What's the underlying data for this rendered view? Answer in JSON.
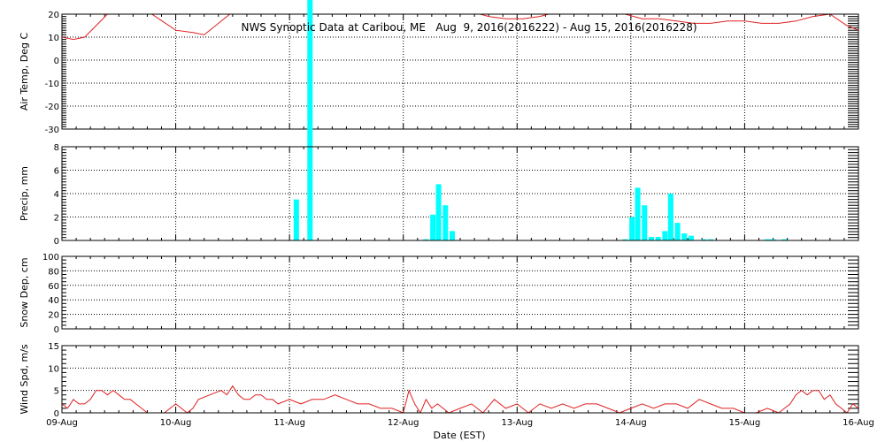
{
  "chart_data": {
    "type": "line",
    "title": "NWS Synoptic Data at Caribou, ME   Aug  9, 2016(2016222) - Aug 15, 2016(2016228)",
    "xlabel": "Date (EST)",
    "x_ticks": [
      "09-Aug",
      "10-Aug",
      "11-Aug",
      "12-Aug",
      "13-Aug",
      "14-Aug",
      "15-Aug",
      "16-Aug"
    ],
    "xlim_days": [
      0,
      7
    ],
    "grid": true,
    "colors": {
      "line": "#e02020",
      "bar": "#00ffff",
      "grid": "#000000"
    },
    "panels": [
      {
        "id": "air_temp",
        "type": "line",
        "ylabel": "Air Temp, Deg C",
        "ylim": [
          -30,
          20
        ],
        "y_ticks": [
          20,
          10,
          0,
          -10,
          -20,
          -30
        ],
        "series": [
          {
            "x": [
              0.0,
              0.1,
              0.2,
              0.3,
              0.4,
              0.55,
              0.7,
              0.85,
              1.0,
              1.15,
              1.25,
              1.35,
              1.5,
              1.65,
              1.8,
              1.95,
              2.1,
              2.25,
              2.4,
              2.55,
              2.7,
              2.85,
              3.0,
              3.15,
              3.3,
              3.45,
              3.6,
              3.75,
              3.9,
              4.05,
              4.2,
              4.35,
              4.5,
              4.65,
              4.8,
              4.95,
              5.1,
              5.25,
              5.4,
              5.55,
              5.7,
              5.85,
              6.0,
              6.15,
              6.3,
              6.45,
              6.6,
              6.75,
              6.9,
              7.0
            ],
            "y": [
              10,
              9,
              10,
              15,
              20,
              22,
              23,
              18,
              13,
              12,
              11,
              15,
              21,
              24,
              22,
              20,
              20,
              21,
              21,
              23,
              23,
              24,
              24,
              22,
              21,
              20,
              21,
              19,
              18,
              18,
              19,
              21,
              22,
              23,
              22,
              20,
              18,
              18,
              17,
              16,
              16,
              17,
              17,
              16,
              16,
              17,
              19,
              20,
              15,
              13
            ]
          }
        ]
      },
      {
        "id": "precip",
        "type": "bar",
        "ylabel": "Precip, mm",
        "ylim": [
          0,
          8
        ],
        "y_ticks": [
          8,
          6,
          4,
          2,
          0
        ],
        "bars": {
          "x": [
            2.06,
            2.18,
            3.2,
            3.26,
            3.31,
            3.37,
            3.43,
            4.95,
            5.01,
            5.06,
            5.12,
            5.18,
            5.24,
            5.3,
            5.35,
            5.41,
            5.47,
            5.53,
            5.64,
            5.7,
            6.2,
            6.25,
            6.35
          ],
          "y": [
            3.5,
            30,
            0.1,
            2.2,
            4.8,
            3.0,
            0.8,
            0.1,
            2.0,
            4.5,
            3.0,
            0.3,
            0.3,
            0.8,
            4.0,
            1.5,
            0.6,
            0.4,
            0.1,
            0.1,
            0.1,
            0.1,
            0.1
          ]
        }
      },
      {
        "id": "snow_depth",
        "type": "line",
        "ylabel": "Snow Dep, cm",
        "ylim": [
          0,
          100
        ],
        "y_ticks": [
          100,
          80,
          60,
          40,
          20,
          0
        ],
        "series": []
      },
      {
        "id": "wind_speed",
        "type": "line",
        "ylabel": "Wind Spd, m/s",
        "ylim": [
          0,
          15
        ],
        "y_ticks": [
          15,
          10,
          5,
          0
        ],
        "series": [
          {
            "x": [
              0.0,
              0.05,
              0.1,
              0.15,
              0.2,
              0.25,
              0.3,
              0.35,
              0.4,
              0.45,
              0.5,
              0.55,
              0.6,
              0.65,
              0.7,
              0.75,
              0.8,
              0.85,
              0.9,
              1.0,
              1.1,
              1.15,
              1.2,
              1.3,
              1.4,
              1.45,
              1.5,
              1.55,
              1.6,
              1.65,
              1.7,
              1.75,
              1.8,
              1.85,
              1.9,
              2.0,
              2.1,
              2.2,
              2.3,
              2.4,
              2.5,
              2.6,
              2.7,
              2.8,
              2.9,
              3.0,
              3.05,
              3.1,
              3.15,
              3.2,
              3.25,
              3.3,
              3.35,
              3.4,
              3.5,
              3.6,
              3.7,
              3.8,
              3.9,
              4.0,
              4.1,
              4.2,
              4.3,
              4.4,
              4.5,
              4.6,
              4.7,
              4.8,
              4.9,
              5.0,
              5.1,
              5.2,
              5.3,
              5.4,
              5.5,
              5.6,
              5.7,
              5.8,
              5.9,
              6.0,
              6.1,
              6.2,
              6.3,
              6.35,
              6.4,
              6.45,
              6.5,
              6.55,
              6.6,
              6.65,
              6.7,
              6.75,
              6.8,
              6.85,
              6.9,
              6.95,
              7.0
            ],
            "y": [
              2,
              1,
              3,
              2,
              2,
              3,
              5,
              5,
              4,
              5,
              4,
              3,
              3,
              2,
              1,
              0,
              0,
              0,
              0,
              2,
              0,
              1,
              3,
              4,
              5,
              4,
              6,
              4,
              3,
              3,
              4,
              4,
              3,
              3,
              2,
              3,
              2,
              3,
              3,
              4,
              3,
              2,
              2,
              1,
              1,
              0,
              5,
              2,
              0,
              3,
              1,
              2,
              1,
              0,
              1,
              2,
              0,
              3,
              1,
              2,
              0,
              2,
              1,
              2,
              1,
              2,
              2,
              1,
              0,
              1,
              2,
              1,
              2,
              2,
              1,
              3,
              2,
              1,
              1,
              0,
              0,
              1,
              0,
              1,
              2,
              4,
              5,
              4,
              5,
              5,
              3,
              4,
              2,
              1,
              0,
              2,
              1
            ]
          }
        ]
      }
    ]
  }
}
